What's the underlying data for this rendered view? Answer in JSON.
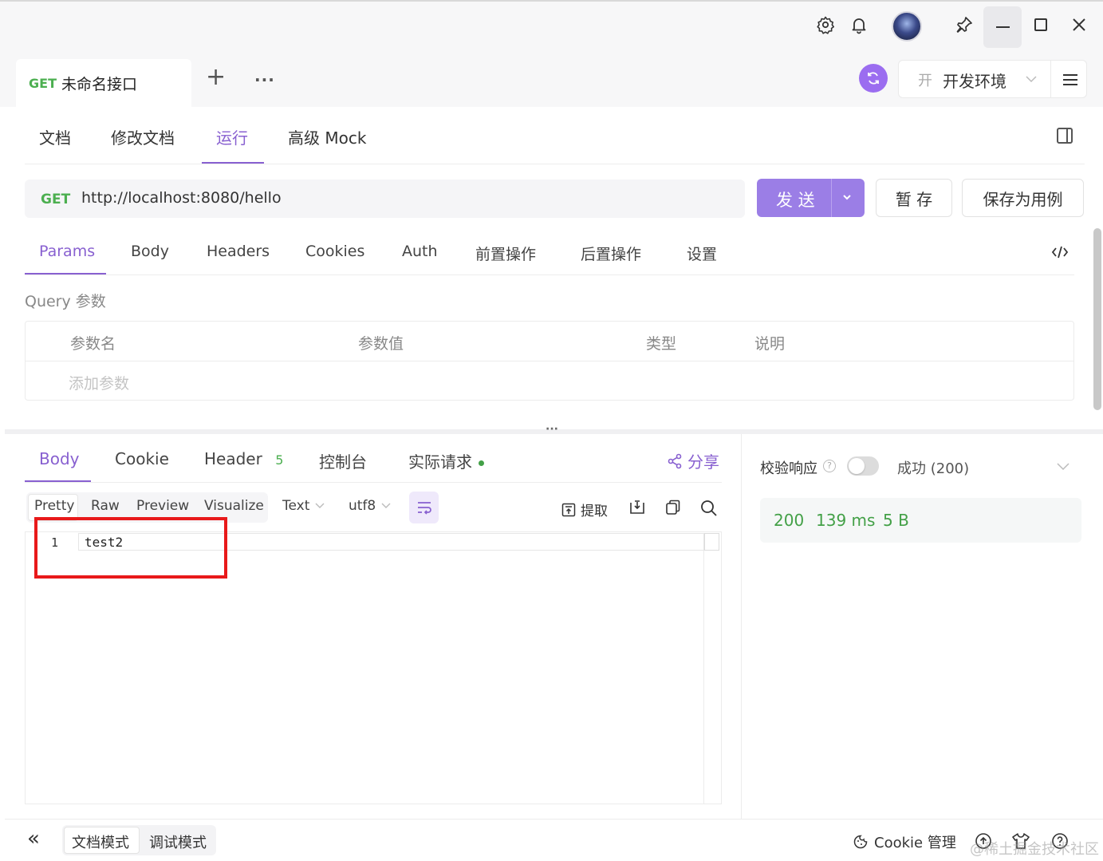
{
  "titlebar": {
    "icons": [
      "gear-icon",
      "bell-icon",
      "avatar",
      "pin-icon",
      "minimize-icon",
      "maximize-icon",
      "close-icon"
    ]
  },
  "tabs": {
    "active": {
      "method": "GET",
      "title": "未命名接口"
    },
    "add": "+",
    "more": "···"
  },
  "env": {
    "badge": "开",
    "name": "开发环境"
  },
  "subtabs": [
    "文档",
    "修改文档",
    "运行",
    "高级 Mock"
  ],
  "subtab_active": "运行",
  "request": {
    "method": "GET",
    "url": "http://localhost:8080/hello",
    "send_label": "发 送",
    "save_label": "暂 存",
    "save_case_label": "保存为用例"
  },
  "request_tabs": [
    "Params",
    "Body",
    "Headers",
    "Cookies",
    "Auth",
    "前置操作",
    "后置操作",
    "设置"
  ],
  "request_tab_active": "Params",
  "params": {
    "section_title": "Query 参数",
    "columns": [
      "参数名",
      "参数值",
      "类型",
      "说明"
    ],
    "add_placeholder": "添加参数"
  },
  "divider_handle": "···",
  "response_tabs": {
    "body": "Body",
    "cookie": "Cookie",
    "header": "Header",
    "header_count": "5",
    "console": "控制台",
    "actual_request": "实际请求",
    "share": "分享"
  },
  "format_bar": {
    "modes": [
      "Pretty",
      "Raw",
      "Preview",
      "Visualize"
    ],
    "active_mode": "Pretty",
    "type": "Text",
    "encoding": "utf8",
    "extract": "提取"
  },
  "editor": {
    "lines": [
      {
        "num": "1",
        "text": "test2"
      }
    ]
  },
  "validate": {
    "label": "校验响应",
    "help": "?",
    "result": "成功 (200)",
    "toggle_on": false
  },
  "status": {
    "code": "200",
    "time": "139 ms",
    "size": "5 B"
  },
  "bottombar": {
    "collapse": "«",
    "doc_mode": "文档模式",
    "debug_mode": "调试模式",
    "cookie_manage": "Cookie 管理",
    "watermark": "@稀土掘金技术社区"
  },
  "colors": {
    "accent": "#8860d0",
    "send_button": "#9b7ee6",
    "get_method": "#4caf50",
    "status_ok": "#43a047",
    "highlight_box": "#e8191a"
  }
}
